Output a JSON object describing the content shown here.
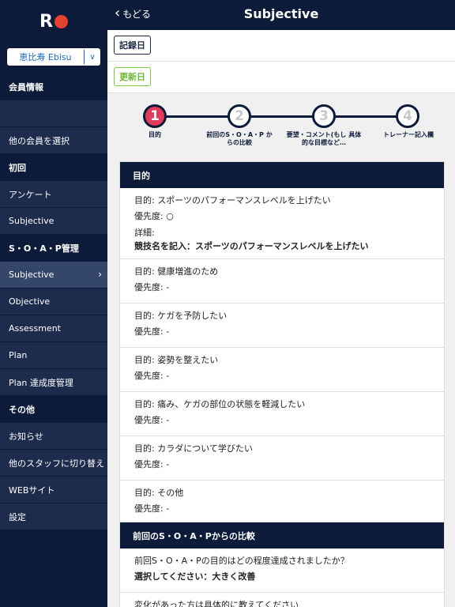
{
  "logo": {
    "text": "R",
    "dot_color": "#e8402e"
  },
  "store_select": {
    "value": "恵比寿 Ebisu",
    "icon": "chevron-down-icon"
  },
  "sidebar": {
    "sections": [
      {
        "header": "会員情報",
        "items": [
          "",
          "他の会員を選択"
        ]
      },
      {
        "header": "初回",
        "items": [
          "アンケート",
          "Subjective"
        ]
      },
      {
        "header": "S・O・A・P管理",
        "items": [
          "Subjective",
          "Objective",
          "Assessment",
          "Plan",
          "Plan 達成度管理"
        ]
      },
      {
        "header": "その他",
        "items": [
          "お知らせ",
          "他のスタッフに切り替え",
          "WEBサイト",
          "設定"
        ]
      }
    ],
    "active_item": "Subjective"
  },
  "topbar": {
    "back_label": "もどる",
    "title": "Subjective"
  },
  "dates": {
    "recorded_label": "記録日",
    "updated_label": "更新日"
  },
  "steps": [
    {
      "number": "1",
      "label": "目的"
    },
    {
      "number": "2",
      "label": "前回のS・O・A・P からの比較"
    },
    {
      "number": "3",
      "label": "要望・コメント(もし 具体的な目標など…"
    },
    {
      "number": "4",
      "label": "トレーナー記入欄"
    }
  ],
  "purpose_card": {
    "title": "目的",
    "rows": [
      {
        "purpose": "目的: スポーツのパフォーマンスレベルを上げたい",
        "priority": "優先度: ○",
        "detail_label": "詳細:",
        "detail": "競技名を記入：スポーツのパフォーマンスレベルを上げたい"
      },
      {
        "purpose": "目的: 健康増進のため",
        "priority": "優先度: -"
      },
      {
        "purpose": "目的: ケガを予防したい",
        "priority": "優先度: -"
      },
      {
        "purpose": "目的: 姿勢を整えたい",
        "priority": "優先度: -"
      },
      {
        "purpose": "目的: 痛み、ケガの部位の状態を軽減したい",
        "priority": "優先度: -"
      },
      {
        "purpose": "目的: カラダについて学びたい",
        "priority": "優先度: -"
      },
      {
        "purpose": "目的: その他",
        "priority": "優先度: -"
      }
    ]
  },
  "compare_card": {
    "title": "前回のS・O・A・Pからの比較",
    "question": "前回S・O・A・Pの目的はどの程度達成されましたか？",
    "answer": "選択してください：大きく改善",
    "followup": "変化があった方は具体的に教えてください"
  }
}
